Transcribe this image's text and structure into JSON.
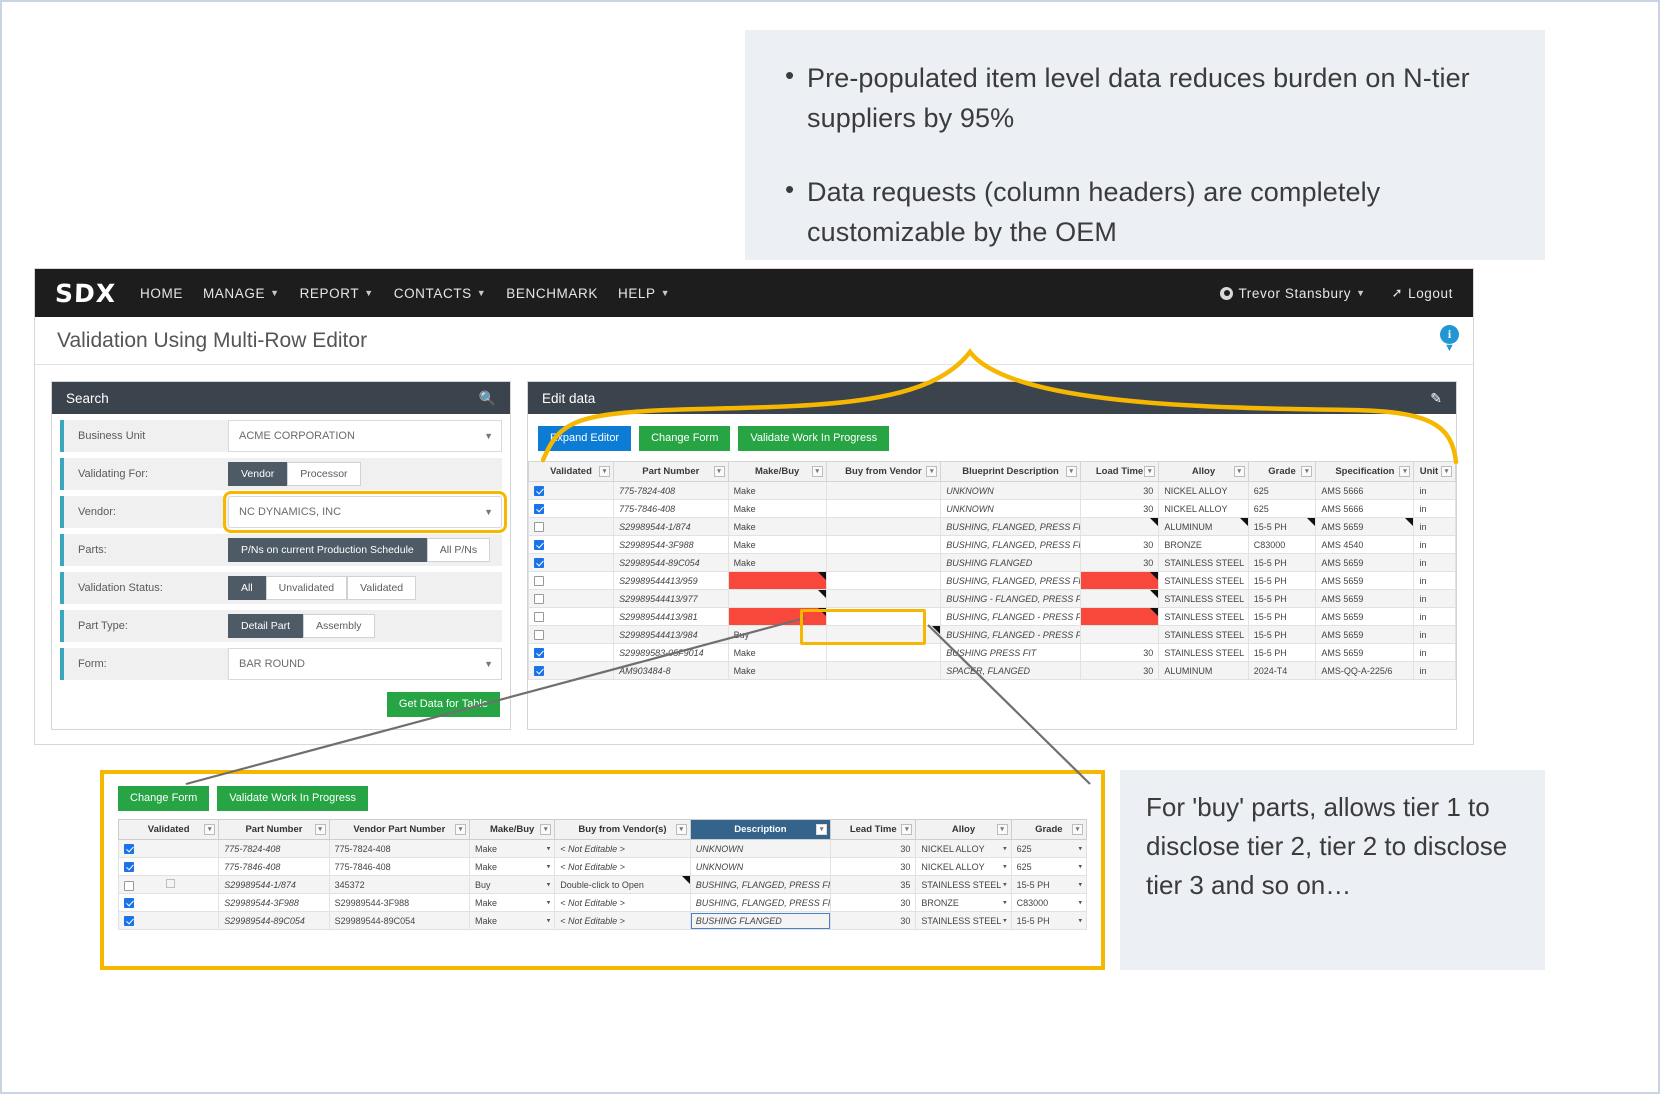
{
  "bullets": [
    "Pre-populated item level data reduces burden on N-tier suppliers by 95%",
    "Data requests (column headers) are completely customizable by the OEM"
  ],
  "navbar": {
    "logo": "SDX",
    "items": [
      {
        "label": "HOME",
        "caret": false
      },
      {
        "label": "MANAGE",
        "caret": true
      },
      {
        "label": "REPORT",
        "caret": true
      },
      {
        "label": "CONTACTS",
        "caret": true
      },
      {
        "label": "BENCHMARK",
        "caret": false
      },
      {
        "label": "HELP",
        "caret": true
      }
    ],
    "user": "Trevor Stansbury",
    "logout": "Logout"
  },
  "page": {
    "title": "Validation Using Multi-Row Editor"
  },
  "search": {
    "header": "Search",
    "search_icon": "search-icon",
    "fields": [
      {
        "label": "Business Unit",
        "type": "select",
        "value": "ACME CORPORATION"
      },
      {
        "label": "Validating For:",
        "type": "toggle",
        "options": [
          "Vendor",
          "Processor"
        ],
        "selected": "Vendor"
      },
      {
        "label": "Vendor:",
        "type": "select",
        "value": "NC DYNAMICS, INC",
        "highlighted": true
      },
      {
        "label": "Parts:",
        "type": "toggle",
        "options": [
          "P/Ns on current Production Schedule",
          "All P/Ns"
        ],
        "selected": "P/Ns on current Production Schedule"
      },
      {
        "label": "Validation Status:",
        "type": "toggle",
        "options": [
          "All",
          "Unvalidated",
          "Validated"
        ],
        "selected": "All"
      },
      {
        "label": "Part Type:",
        "type": "toggle",
        "options": [
          "Detail Part",
          "Assembly"
        ],
        "selected": "Detail Part"
      },
      {
        "label": "Form:",
        "type": "select",
        "value": "BAR ROUND"
      }
    ],
    "submit_label": "Get Data for Table"
  },
  "edit_panel": {
    "header": "Edit data",
    "edit_icon": "pencil-icon",
    "buttons": [
      {
        "label": "Expand Editor",
        "color": "#0c7cd5"
      },
      {
        "label": "Change Form",
        "color": "#27a544"
      },
      {
        "label": "Validate Work In Progress",
        "color": "#27a544"
      }
    ],
    "columns": [
      "Validated",
      "Part Number",
      "Make/Buy",
      "Buy from Vendor",
      "Blueprint Description",
      "Load Time",
      "Alloy",
      "Grade",
      "Specification",
      "Unit of"
    ],
    "rows": [
      {
        "validated": true,
        "part": "775-7824-408",
        "makebuy": "Make",
        "buyvendor": "",
        "desc": "UNKNOWN",
        "lead": "30",
        "alloy": "NICKEL ALLOY",
        "grade": "625",
        "spec": "AMS 5666",
        "unit": "in"
      },
      {
        "validated": true,
        "part": "775-7846-408",
        "makebuy": "Make",
        "buyvendor": "",
        "desc": "UNKNOWN",
        "lead": "30",
        "alloy": "NICKEL ALLOY",
        "grade": "625",
        "spec": "AMS 5666",
        "unit": "in"
      },
      {
        "validated": false,
        "part": "S29989544-1/874",
        "makebuy": "Make",
        "buyvendor": "",
        "desc": "BUSHING, FLANGED, PRESS FIT",
        "lead": "",
        "alloy": "ALUMINUM",
        "grade": "15-5 PH",
        "spec": "AMS 5659",
        "unit": "in",
        "red": [
          "lead",
          "alloy",
          "grade",
          "spec"
        ]
      },
      {
        "validated": true,
        "part": "S29989544-3F988",
        "makebuy": "Make",
        "buyvendor": "",
        "desc": "BUSHING, FLANGED, PRESS FIT",
        "lead": "30",
        "alloy": "BRONZE",
        "grade": "C83000",
        "spec": "AMS 4540",
        "unit": "in"
      },
      {
        "validated": true,
        "part": "S29989544-89C054",
        "makebuy": "Make",
        "buyvendor": "",
        "desc": "BUSHING FLANGED",
        "lead": "30",
        "alloy": "STAINLESS STEEL",
        "grade": "15-5 PH",
        "spec": "AMS 5659",
        "unit": "in"
      },
      {
        "validated": false,
        "part": "S29989544413/959",
        "makebuy": "",
        "buyvendor": "",
        "desc": "BUSHING, FLANGED, PRESS FIT",
        "lead": "",
        "alloy": "STAINLESS STEEL",
        "grade": "15-5 PH",
        "spec": "AMS 5659",
        "unit": "in",
        "red": [
          "makebuy",
          "lead"
        ]
      },
      {
        "validated": false,
        "part": "S29989544413/977",
        "makebuy": "",
        "buyvendor": "",
        "desc": "BUSHING - FLANGED, PRESS FIT",
        "lead": "",
        "alloy": "STAINLESS STEEL",
        "grade": "15-5 PH",
        "spec": "AMS 5659",
        "unit": "in",
        "red": [
          "makebuy",
          "lead"
        ]
      },
      {
        "validated": false,
        "part": "S29989544413/981",
        "makebuy": "",
        "buyvendor": "",
        "desc": "BUSHING, FLANGED - PRESS FIT",
        "lead": "",
        "alloy": "STAINLESS STEEL",
        "grade": "15-5 PH",
        "spec": "AMS 5659",
        "unit": "in",
        "red": [
          "makebuy",
          "lead"
        ]
      },
      {
        "validated": false,
        "part": "S29989544413/984",
        "makebuy": "Buy",
        "buyvendor": "",
        "desc": "BUSHING, FLANGED - PRESS FIT",
        "lead": "",
        "alloy": "STAINLESS STEEL",
        "grade": "15-5 PH",
        "spec": "AMS 5659",
        "unit": "in",
        "red": [
          "buyvendor"
        ]
      },
      {
        "validated": true,
        "part": "S29989583-05F9014",
        "makebuy": "Make",
        "buyvendor": "",
        "desc": "BUSHING PRESS FIT",
        "lead": "30",
        "alloy": "STAINLESS STEEL",
        "grade": "15-5 PH",
        "spec": "AMS 5659",
        "unit": "in"
      },
      {
        "validated": true,
        "part": "AM903484-8",
        "makebuy": "Make",
        "buyvendor": "",
        "desc": "SPACER, FLANGED",
        "lead": "30",
        "alloy": "ALUMINUM",
        "grade": "2024-T4",
        "spec": "AMS-QQ-A-225/6",
        "unit": "in"
      }
    ]
  },
  "detail_panel": {
    "buttons": [
      {
        "label": "Change Form",
        "color": "#27a544"
      },
      {
        "label": "Validate Work In Progress",
        "color": "#27a544"
      }
    ],
    "columns": [
      "Validated",
      "Part Number",
      "Vendor Part Number",
      "Make/Buy",
      "Buy from Vendor(s)",
      "Description",
      "Lead Time",
      "Alloy",
      "Grade"
    ],
    "selected_column": "Description",
    "rows": [
      {
        "validated": true,
        "part": "775-7824-408",
        "vendor_part": "775-7824-408",
        "makebuy": "Make",
        "buyvendor": "< Not Editable >",
        "desc": "UNKNOWN",
        "lead": "30",
        "alloy": "NICKEL ALLOY",
        "grade": "625"
      },
      {
        "validated": true,
        "part": "775-7846-408",
        "vendor_part": "775-7846-408",
        "makebuy": "Make",
        "buyvendor": "< Not Editable >",
        "desc": "UNKNOWN",
        "lead": "30",
        "alloy": "NICKEL ALLOY",
        "grade": "625"
      },
      {
        "validated": false,
        "part": "S29989544-1/874",
        "vendor_part": "345372",
        "makebuy": "Buy",
        "buyvendor": "Double-click to Open",
        "buyvendor_red": true,
        "desc": "BUSHING, FLANGED, PRESS FIT",
        "lead": "35",
        "alloy": "STAINLESS STEEL",
        "grade": "15-5 PH",
        "has_grid_icon": true
      },
      {
        "validated": true,
        "part": "S29989544-3F988",
        "vendor_part": "S29989544-3F988",
        "makebuy": "Make",
        "buyvendor": "< Not Editable >",
        "desc": "BUSHING, FLANGED, PRESS FIT",
        "lead": "30",
        "alloy": "BRONZE",
        "grade": "C83000"
      },
      {
        "validated": true,
        "part": "S29989544-89C054",
        "vendor_part": "S29989544-89C054",
        "makebuy": "Make",
        "buyvendor": "< Not Editable >",
        "desc": "BUSHING FLANGED",
        "desc_focus": true,
        "lead": "30",
        "alloy": "STAINLESS STEEL",
        "grade": "15-5 PH"
      }
    ]
  },
  "right_caption": "For 'buy' parts, allows tier 1 to disclose tier 2, tier 2 to disclose tier 3 and so on…",
  "colors": {
    "navbar": "#1d1d1d",
    "panel_header": "#3b444d",
    "accent_teal": "#3ba7bd",
    "highlight_yellow": "#f5b700",
    "error_red": "#f8483c",
    "green": "#27a544",
    "blue": "#0c7cd5",
    "selected_header": "#34638c"
  }
}
